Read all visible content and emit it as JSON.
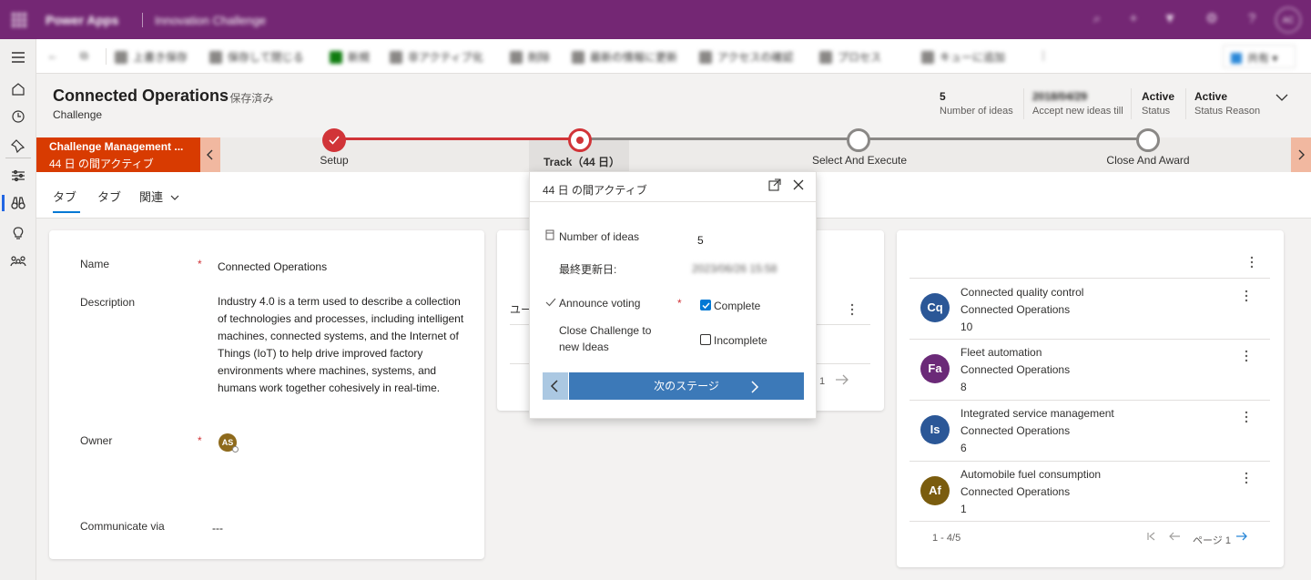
{
  "topbar": {
    "app_name": "Power Apps",
    "environment": "Innovation Challenge",
    "user_initials": "AC"
  },
  "commands": [
    {
      "label": "上書き保存"
    },
    {
      "label": "保存して閉じる"
    },
    {
      "label": "新規"
    },
    {
      "label": "非アクティブ化"
    },
    {
      "label": "削除"
    },
    {
      "label": "最新の情報に更新"
    },
    {
      "label": "アクセスの確認"
    },
    {
      "label": "プロセス"
    },
    {
      "label": "キューに追加"
    }
  ],
  "share_label": "共有",
  "record": {
    "title": "Connected Operations",
    "saved_status": "- 保存済み",
    "entity": "Challenge",
    "header_fields": [
      {
        "value": "5",
        "label": "Number of ideas"
      },
      {
        "value": "2018/04/29",
        "label": "Accept new ideas till"
      },
      {
        "value": "Active",
        "label": "Status"
      },
      {
        "value": "Active",
        "label": "Status Reason"
      }
    ]
  },
  "bpf": {
    "process_name": "Challenge Management ...",
    "duration": "44 日 の間アクティブ",
    "stages": [
      "Setup",
      "Track（44 日）",
      "Select And Execute",
      "Close And Award"
    ]
  },
  "tabs": [
    "タブ",
    "タブ",
    "関連"
  ],
  "form": {
    "name_label": "Name",
    "name_value": "Connected Operations",
    "description_label": "Description",
    "description_value": "Industry 4.0 is a term used to describe a collection of technologies and processes, including intelligent machines, connected systems, and the Internet of Things (IoT) to help drive improved factory environments where machines, systems, and humans work together cohesively in real-time.",
    "owner_label": "Owner",
    "owner_initials": "AS",
    "communicate_label": "Communicate via",
    "communicate_value": "---",
    "required_mark": "*"
  },
  "middle_card": {
    "partial_label": "ユー",
    "page_fragment": "1"
  },
  "flyout": {
    "title": "44 日 の間アクティブ",
    "number_label": "Number of ideas",
    "number_value": "5",
    "modified_label": "最終更新日:",
    "modified_value": "2023/06/26 15:58",
    "voting_label": "Announce voting",
    "voting_option": "Complete",
    "close_label_1": "Close Challenge to",
    "close_label_2": "new Ideas",
    "close_option": "Incomplete",
    "next_label": "次のステージ",
    "required_mark": "*"
  },
  "ideas": {
    "items": [
      {
        "initials": "Cq",
        "title": "Connected quality control",
        "challenge": "Connected Operations",
        "votes": "10",
        "color": "#2b5797"
      },
      {
        "initials": "Fa",
        "title": "Fleet automation",
        "challenge": "Connected Operations",
        "votes": "8",
        "color": "#6b2a78"
      },
      {
        "initials": "Is",
        "title": "Integrated service management",
        "challenge": "Connected Operations",
        "votes": "6",
        "color": "#2b5797"
      },
      {
        "initials": "Af",
        "title": "Automobile fuel consumption",
        "challenge": "Connected Operations",
        "votes": "1",
        "color": "#7a5c0e"
      }
    ],
    "range": "1 - 4/5",
    "page": "ページ 1"
  },
  "colors": {
    "brand": "#742774",
    "active_stage": "#d83b01",
    "stage_complete": "#d13438",
    "primary": "#3c79b8"
  }
}
